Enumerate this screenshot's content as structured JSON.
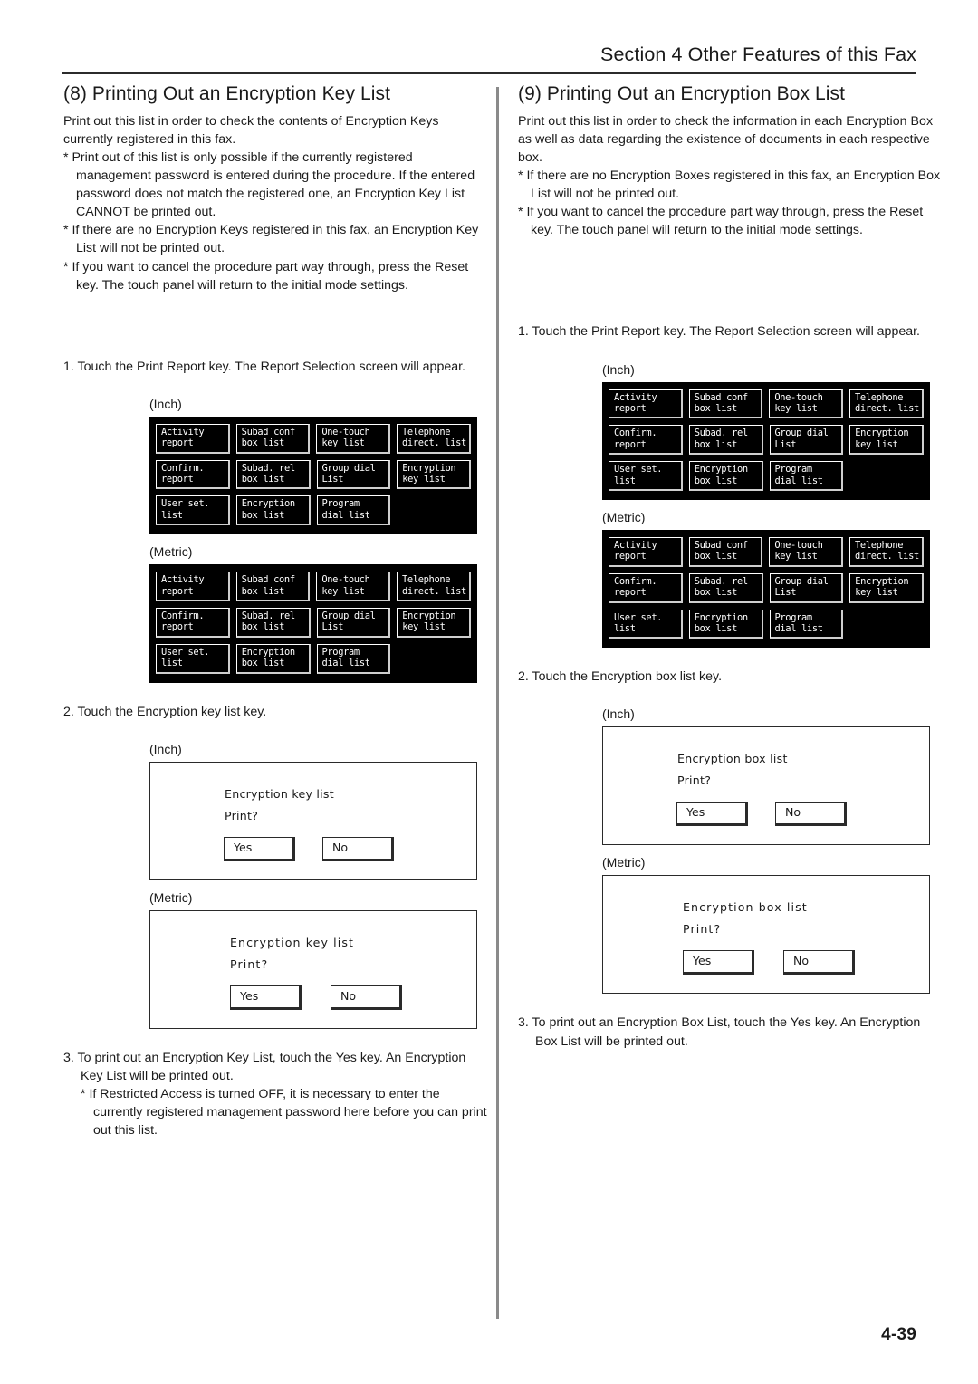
{
  "header": {
    "section_title": "Section 4 Other Features of this Fax"
  },
  "footer": {
    "page_number": "4-39"
  },
  "left_column": {
    "heading": "(8) Printing Out an Encryption Key List",
    "intro": "Print out this list in order to check the contents of Encryption Keys currently registered in this fax.",
    "notes": [
      "* Print out of this list is only possible if the currently registered management password is entered during the procedure. If the entered password does not match the registered one, an Encryption Key List CANNOT be printed out.",
      "* If there are no Encryption Keys registered in this fax, an Encryption Key List will not be printed out.",
      "* If you want to cancel the procedure part way through, press the Reset key. The touch panel will return to the initial mode settings."
    ],
    "step1": "1. Touch the  Print Report  key. The Report Selection screen will appear.",
    "step2": "2. Touch the  Encryption key list  key.",
    "step3": "3. To print out an Encryption Key List, touch the  Yes  key. An Encryption Key List will be printed out.",
    "step3_note": "* If Restricted Access is turned OFF, it is necessary to enter the currently registered management password here before you can print out this list.",
    "fig_inch_label": "(Inch)",
    "fig_metric_label": "(Metric)",
    "dialog": {
      "title": "Encryption key list",
      "prompt": "Print?",
      "yes_label": "Yes",
      "no_label": "No"
    }
  },
  "right_column": {
    "heading": "(9) Printing Out an Encryption Box List",
    "intro": "Print out this list in order to check the information in each Encryption Box as well as data regarding the existence of documents in each respective box.",
    "notes": [
      "* If there are no Encryption Boxes registered in this fax, an Encryption Box List will not be printed out.",
      "* If you want to cancel the procedure part way through, press the Reset key. The touch panel will return to the initial mode settings."
    ],
    "step1": "1. Touch the  Print Report  key. The Report Selection screen will appear.",
    "step2": "2. Touch the  Encryption box list  key.",
    "step3": "3. To print out an Encryption Box List, touch the  Yes  key. An Encryption Box List will be printed out.",
    "fig_inch_label": "(Inch)",
    "fig_metric_label": "(Metric)",
    "dialog": {
      "title": "Encryption box list",
      "prompt": "Print?",
      "yes_label": "Yes",
      "no_label": "No"
    }
  },
  "report_selection_screen": {
    "rows": [
      [
        {
          "line1": "Activity",
          "line2": "report"
        },
        {
          "line1": "Subad conf",
          "line2": "box list"
        },
        {
          "line1": "One-touch",
          "line2": "key list"
        },
        {
          "line1": "Telephone",
          "line2": "direct. list"
        }
      ],
      [
        {
          "line1": "Confirm.",
          "line2": "report"
        },
        {
          "line1": "Subad. rel",
          "line2": "box list"
        },
        {
          "line1": "Group dial",
          "line2": "List"
        },
        {
          "line1": "Encryption",
          "line2": "key list"
        }
      ],
      [
        {
          "line1": "User set.",
          "line2": "list"
        },
        {
          "line1": "Encryption",
          "line2": "box list"
        },
        {
          "line1": "Program",
          "line2": "dial list"
        },
        {
          "line1": "",
          "line2": ""
        }
      ]
    ]
  }
}
